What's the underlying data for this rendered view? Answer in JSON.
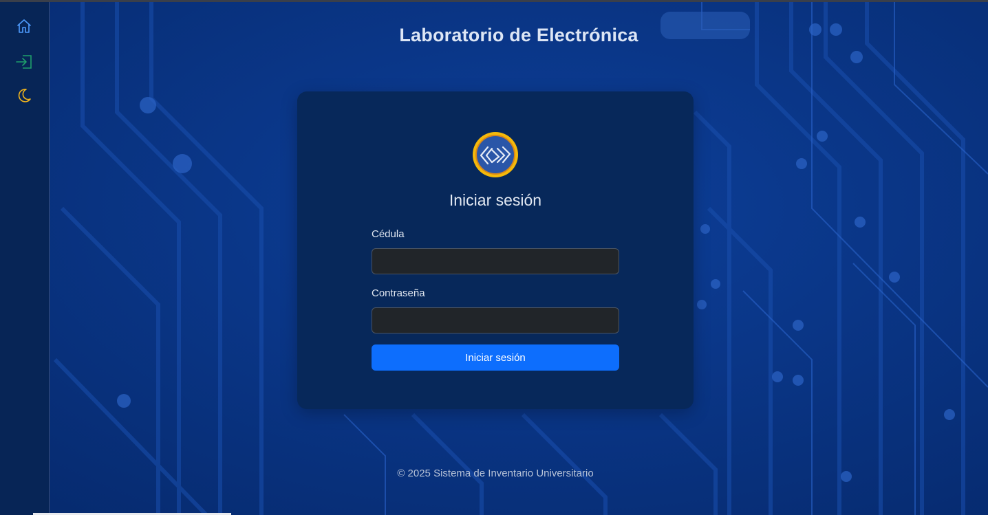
{
  "app": {
    "title": "Laboratorio de Electrónica",
    "footer": "© 2025 Sistema de Inventario Universitario"
  },
  "sidebar": {
    "items": [
      {
        "icon": "home-icon",
        "color": "#4f9cff"
      },
      {
        "icon": "login-icon",
        "color": "#1fa06b"
      },
      {
        "icon": "moon-icon",
        "color": "#f2b51c"
      }
    ]
  },
  "login": {
    "heading": "Iniciar sesión",
    "cedula_label": "Cédula",
    "cedula_value": "",
    "password_label": "Contraseña",
    "password_value": "",
    "submit_label": "Iniciar sesión"
  },
  "colors": {
    "primary_button": "#0d6efd",
    "card_bg": "#07285a",
    "input_bg": "#212529",
    "logo_ring": "#f5b90a"
  }
}
